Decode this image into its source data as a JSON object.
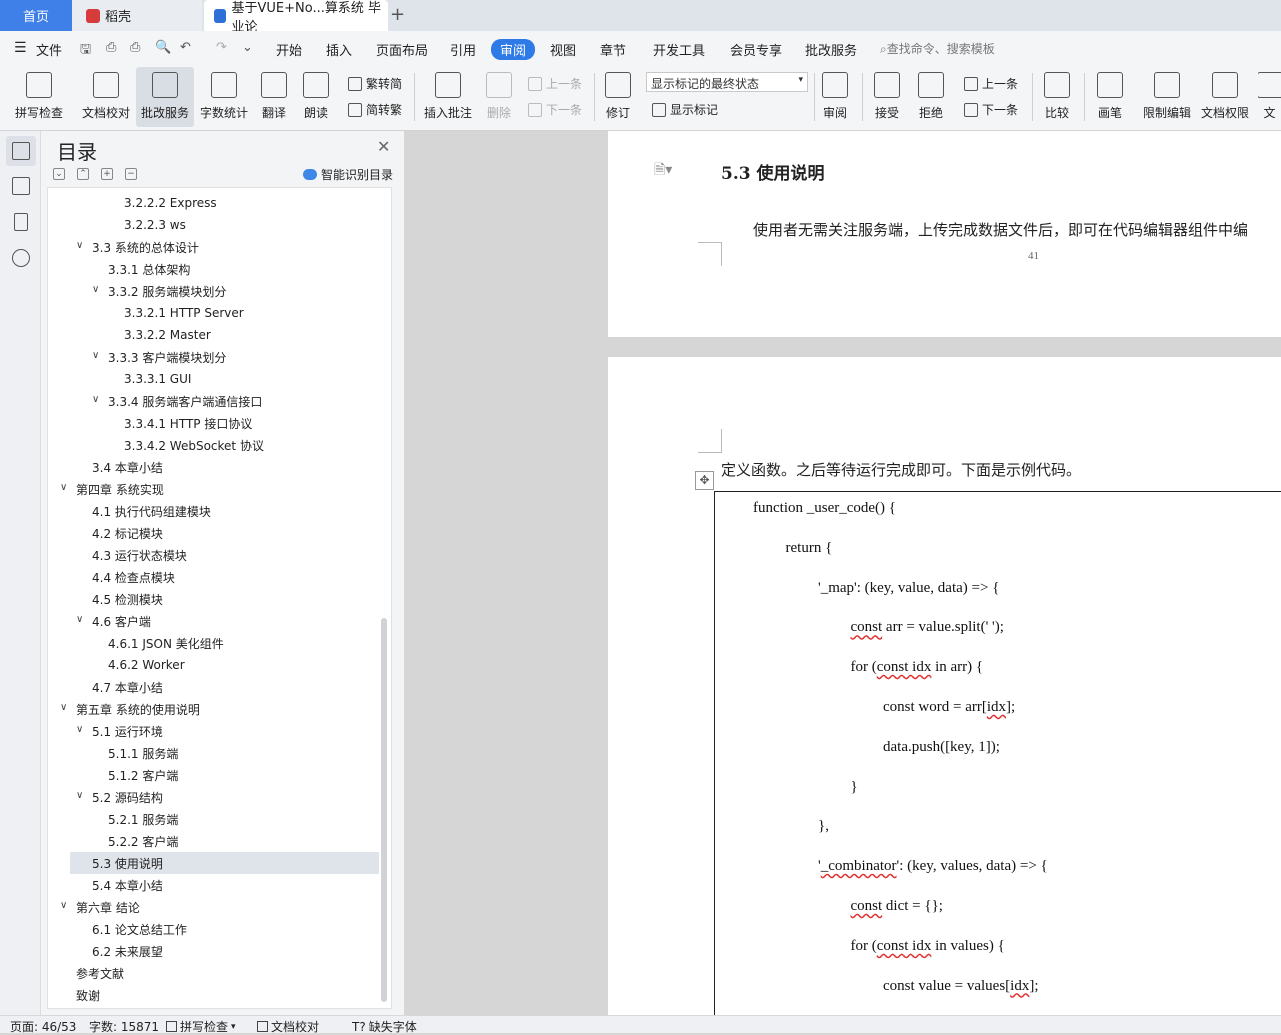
{
  "tabs": {
    "home": "首页",
    "daoke": "稻壳",
    "doc": "基于VUE+No...算系统 毕业论",
    "new": "+"
  },
  "menu": {
    "items": [
      "文件",
      "开始",
      "插入",
      "页面布局",
      "引用",
      "审阅",
      "视图",
      "章节",
      "开发工具",
      "会员专享",
      "批改服务"
    ],
    "search": "查找命令、搜索模板"
  },
  "ribbon": {
    "spell": "拼写检查",
    "proof": "文档校对",
    "revise_service": "批改服务",
    "wordcount": "字数统计",
    "translate": "翻译",
    "read": "朗读",
    "trad": "繁转简",
    "simp": "简转繁",
    "insert_comment": "插入批注",
    "delete": "删除",
    "prev_comment": "上一条",
    "next_comment": "下一条",
    "track": "修订",
    "markup_state": "显示标记的最终状态",
    "show_markup": "显示标记",
    "review": "审阅",
    "accept": "接受",
    "reject": "拒绝",
    "prev": "上一条",
    "next": "下一条",
    "compare": "比较",
    "pen": "画笔",
    "restrict": "限制编辑",
    "doc_rights": "文档权限",
    "more": "文"
  },
  "toc": {
    "title": "目录",
    "smart": "智能识别目录",
    "items": [
      {
        "text": "3.2.2.2  Express",
        "level": 4
      },
      {
        "text": "3.2.2.3  ws",
        "level": 4
      },
      {
        "text": "3.3  系统的总体设计",
        "level": 2,
        "toggle": "∨"
      },
      {
        "text": "3.3.1  总体架构",
        "level": 3
      },
      {
        "text": "3.3.2  服务端模块划分",
        "level": 3,
        "toggle": "∨"
      },
      {
        "text": "3.3.2.1  HTTP Server",
        "level": 4
      },
      {
        "text": "3.3.2.2  Master",
        "level": 4
      },
      {
        "text": "3.3.3  客户端模块划分",
        "level": 3,
        "toggle": "∨"
      },
      {
        "text": "3.3.3.1  GUI",
        "level": 4
      },
      {
        "text": "3.3.4  服务端客户端通信接口",
        "level": 3,
        "toggle": "∨"
      },
      {
        "text": "3.3.4.1  HTTP 接口协议",
        "level": 4
      },
      {
        "text": "3.3.4.2  WebSocket 协议",
        "level": 4
      },
      {
        "text": "3.4  本章小结",
        "level": 2
      },
      {
        "text": "第四章  系统实现",
        "level": 1,
        "toggle": "∨"
      },
      {
        "text": "4.1  执行代码组建模块",
        "level": 2
      },
      {
        "text": "4.2  标记模块",
        "level": 2
      },
      {
        "text": "4.3  运行状态模块",
        "level": 2
      },
      {
        "text": "4.4  检查点模块",
        "level": 2
      },
      {
        "text": "4.5  检测模块",
        "level": 2
      },
      {
        "text": "4.6  客户端",
        "level": 2,
        "toggle": "∨"
      },
      {
        "text": "4.6.1  JSON 美化组件",
        "level": 3
      },
      {
        "text": "4.6.2  Worker",
        "level": 3
      },
      {
        "text": "4.7  本章小结",
        "level": 2
      },
      {
        "text": "第五章  系统的使用说明",
        "level": 1,
        "toggle": "∨"
      },
      {
        "text": "5.1  运行环境",
        "level": 2,
        "toggle": "∨"
      },
      {
        "text": "5.1.1  服务端",
        "level": 3
      },
      {
        "text": "5.1.2  客户端",
        "level": 3
      },
      {
        "text": "5.2  源码结构",
        "level": 2,
        "toggle": "∨"
      },
      {
        "text": "5.2.1  服务端",
        "level": 3
      },
      {
        "text": "5.2.2  客户端",
        "level": 3
      },
      {
        "text": "5.3  使用说明",
        "level": 2,
        "selected": true
      },
      {
        "text": "5.4  本章小结",
        "level": 2
      },
      {
        "text": "第六章  结论",
        "level": 1,
        "toggle": "∨"
      },
      {
        "text": "6.1  论文总结工作",
        "level": 2
      },
      {
        "text": "6.2  未来展望",
        "level": 2
      },
      {
        "text": "参考文献",
        "level": 1
      },
      {
        "text": "致谢",
        "level": 1
      }
    ]
  },
  "document": {
    "heading": "5.3  使用说明",
    "para1": "使用者无需关注服务端，上传完成数据文件后，即可在代码编辑器组件中编",
    "page_number": "41",
    "para2": "定义函数。之后等待运行完成即可。下面是示例代码。",
    "code": [
      {
        "indent": 0,
        "parts": [
          {
            "t": "function _user_code() {"
          }
        ]
      },
      {
        "indent": 1,
        "parts": [
          {
            "t": "return {"
          }
        ]
      },
      {
        "indent": 2,
        "parts": [
          {
            "t": "'_map': (key, value, data) => {"
          }
        ]
      },
      {
        "indent": 3,
        "parts": [
          {
            "t": "const",
            "sq": true
          },
          {
            "t": " arr = value.split(' ');"
          }
        ]
      },
      {
        "indent": 3,
        "parts": [
          {
            "t": "for ("
          },
          {
            "t": "const idx",
            "sq": true
          },
          {
            "t": " in arr) {"
          }
        ]
      },
      {
        "indent": 4,
        "parts": [
          {
            "t": "const word = arr["
          },
          {
            "t": "idx",
            "sq": true
          },
          {
            "t": "];"
          }
        ]
      },
      {
        "indent": 4,
        "parts": [
          {
            "t": "data.push([key, 1]);"
          }
        ]
      },
      {
        "indent": 3,
        "parts": [
          {
            "t": "}"
          }
        ]
      },
      {
        "indent": 2,
        "parts": [
          {
            "t": "},"
          }
        ]
      },
      {
        "indent": 2,
        "parts": [
          {
            "t": "'"
          },
          {
            "t": "_combinator",
            "sq": true
          },
          {
            "t": "': (key, values, data) => {"
          }
        ]
      },
      {
        "indent": 3,
        "parts": [
          {
            "t": "const",
            "sq": true
          },
          {
            "t": " dict = {};"
          }
        ]
      },
      {
        "indent": 3,
        "parts": [
          {
            "t": "for ("
          },
          {
            "t": "const idx",
            "sq": true
          },
          {
            "t": " in values) {"
          }
        ]
      },
      {
        "indent": 4,
        "parts": [
          {
            "t": "const value = values["
          },
          {
            "t": "idx",
            "sq": true
          },
          {
            "t": "];"
          }
        ]
      }
    ]
  },
  "status": {
    "page": "页面: 46/53",
    "words": "字数: 15871",
    "spell": "拼写检查",
    "proof": "文档校对",
    "font": "缺失字体"
  }
}
